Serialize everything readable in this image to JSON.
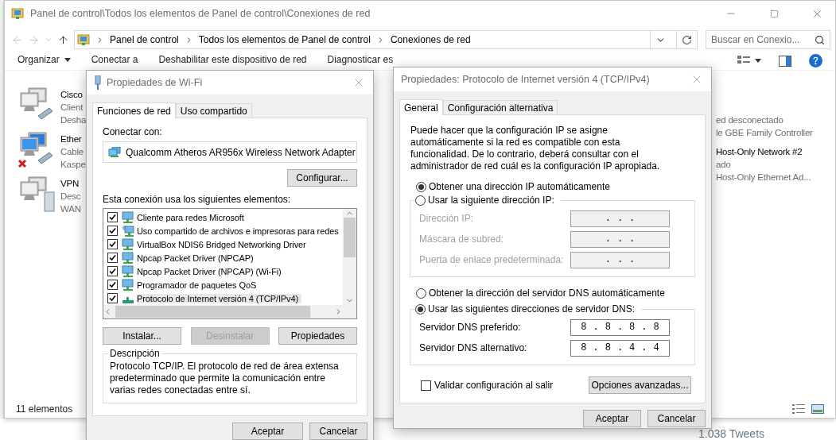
{
  "explorer": {
    "title": "Panel de control\\Todos los elementos de Panel de control\\Conexiones de red",
    "breadcrumb": [
      "Panel de control",
      "Todos los elementos de Panel de control",
      "Conexiones de red"
    ],
    "search": {
      "placeholder": "Buscar en Conexio..."
    },
    "toolbar": [
      {
        "label": "Organizar",
        "menu": true
      },
      {
        "label": "Conectar a",
        "menu": false
      },
      {
        "label": "Deshabilitar este dispositivo de red",
        "menu": false
      },
      {
        "label": "Diagnosticar es",
        "menu": false
      }
    ],
    "connections": [
      {
        "kind": "cable",
        "disconnected": false,
        "lines": [
          "Cisco",
          "Client",
          "Desha"
        ]
      },
      {
        "kind": "cable",
        "disconnected": true,
        "lines": [
          "Ether",
          "Cable",
          "Kaspe"
        ]
      },
      {
        "kind": "vpn",
        "disconnected": false,
        "lines": [
          "VPN",
          "Desc",
          "WAN"
        ]
      }
    ],
    "connections_right": [
      {
        "lines": [
          "ed desconectado",
          "le GBE Family Controller"
        ]
      },
      {
        "name": "Host-Only Network #2",
        "lines": [
          "ado",
          "Host-Only Ethernet Ad..."
        ]
      }
    ],
    "status_bar": "11 elementos"
  },
  "wifi_dialog": {
    "title": "Propiedades de Wi-Fi",
    "tabs": [
      {
        "label": "Funciones de red",
        "selected": true
      },
      {
        "label": "Uso compartido",
        "selected": false
      }
    ],
    "connect_label": "Conectar con:",
    "adapter": "Qualcomm Atheros AR956x Wireless Network Adapter",
    "configure_button": "Configurar...",
    "items_label": "Esta conexión usa los siguientes elementos:",
    "items": [
      {
        "label": "Cliente para redes Microsoft",
        "kind": "client",
        "checked": true,
        "selected": false
      },
      {
        "label": "Uso compartido de archivos e impresoras para redes",
        "kind": "service",
        "checked": true,
        "selected": false
      },
      {
        "label": "VirtualBox NDIS6 Bridged Networking Driver",
        "kind": "client",
        "checked": true,
        "selected": false
      },
      {
        "label": "Npcap Packet Driver (NPCAP)",
        "kind": "client",
        "checked": true,
        "selected": false
      },
      {
        "label": "Npcap Packet Driver (NPCAP) (Wi-Fi)",
        "kind": "client",
        "checked": true,
        "selected": false
      },
      {
        "label": "Programador de paquetes QoS",
        "kind": "client",
        "checked": true,
        "selected": false
      },
      {
        "label": "Protocolo de Internet versión 4 (TCP/IPv4)",
        "kind": "protocol",
        "checked": true,
        "selected": true
      }
    ],
    "buttons": [
      {
        "label": "Instalar...",
        "disabled": false
      },
      {
        "label": "Desinstalar",
        "disabled": true
      },
      {
        "label": "Propiedades",
        "disabled": false
      }
    ],
    "description": {
      "title": "Descripción",
      "text": "Protocolo TCP/IP. El protocolo de red de área extensa predeterminado que permite la comunicación entre varias redes conectadas entre sí."
    },
    "footer_buttons": [
      "Aceptar",
      "Cancelar"
    ]
  },
  "ipv4_dialog": {
    "title": "Propiedades: Protocolo de Internet versión 4 (TCP/IPv4)",
    "tabs": [
      {
        "label": "General",
        "selected": true
      },
      {
        "label": "Configuración alternativa",
        "selected": false
      }
    ],
    "intro": "Puede hacer que la configuración IP se asigne automáticamente si la red es compatible con esta funcionalidad. De lo contrario, deberá consultar con el administrador de red cuál es la configuración IP apropiada.",
    "ip_group": {
      "auto_option": {
        "label": "Obtener una dirección IP automáticamente",
        "selected": true
      },
      "manual_option": {
        "label": "Usar la siguiente dirección IP:",
        "selected": false
      },
      "disabled": true,
      "fields": [
        {
          "label": "Dirección IP:",
          "value": "..."
        },
        {
          "label": "Máscara de subred:",
          "value": "..."
        },
        {
          "label": "Puerta de enlace predeterminada:",
          "value": "..."
        }
      ]
    },
    "dns_group": {
      "auto_option": {
        "label": "Obtener la dirección del servidor DNS automáticamente",
        "selected": false
      },
      "manual_option": {
        "label": "Usar las siguientes direcciones de servidor DNS:",
        "selected": true
      },
      "disabled": false,
      "fields": [
        {
          "label": "Servidor DNS preferido:",
          "value": "8.8.8.8"
        },
        {
          "label": "Servidor DNS alternativo:",
          "value": "8.8.4.4"
        }
      ]
    },
    "validate": {
      "label": "Validar configuración al salir",
      "checked": false
    },
    "advanced_button": "Opciones avanzadas...",
    "footer_buttons": [
      "Aceptar",
      "Cancelar"
    ]
  },
  "background_page": {
    "text": "1.038 Tweets"
  }
}
